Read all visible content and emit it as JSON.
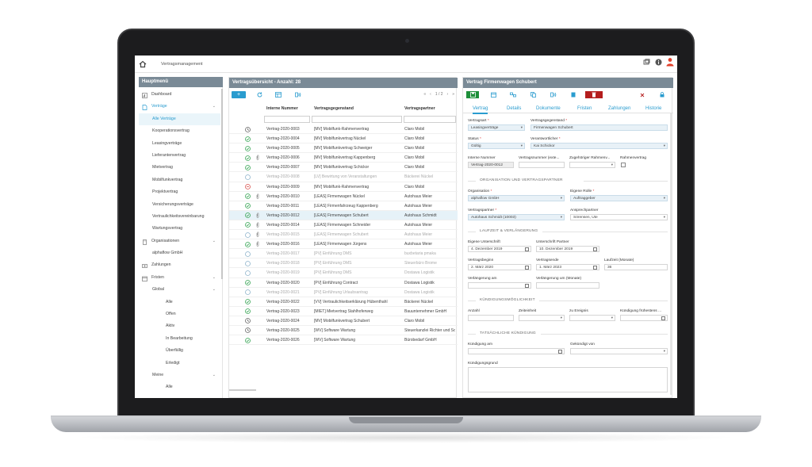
{
  "topbar": {
    "title": "Vertragsmanagement"
  },
  "sidebar": {
    "title": "Hauptmenü",
    "items": [
      {
        "label": "Dashboard",
        "icon": "dashboard-icon",
        "level": 0
      },
      {
        "label": "Verträge",
        "icon": "contract-icon",
        "level": 0,
        "open": true
      },
      {
        "label": "Alle Verträge",
        "level": 1,
        "active": true
      },
      {
        "label": "Kooperationsvertrag",
        "level": 1
      },
      {
        "label": "Leasingverträge",
        "level": 1
      },
      {
        "label": "Lieferantenvertrag",
        "level": 1
      },
      {
        "label": "Mietvertrag",
        "level": 1
      },
      {
        "label": "Mobilfunkvertrag",
        "level": 1
      },
      {
        "label": "Projektvertrag",
        "level": 1
      },
      {
        "label": "Versicherungsverträge",
        "level": 1
      },
      {
        "label": "Vertraulichkeitsvereinbarung",
        "level": 1
      },
      {
        "label": "Wartungsvertrag",
        "level": 1
      },
      {
        "label": "Organisationen",
        "icon": "organization-icon",
        "level": 0,
        "expandable": true
      },
      {
        "label": "alphaflow GmbH",
        "level": 1
      },
      {
        "label": "Zahlungen",
        "icon": "payment-icon",
        "level": 0
      },
      {
        "label": "Fristen",
        "icon": "deadline-icon",
        "level": 0,
        "expandable": true
      },
      {
        "label": "Global",
        "level": 1,
        "expandable": true
      },
      {
        "label": "Alle",
        "level": 2
      },
      {
        "label": "Offen",
        "level": 2
      },
      {
        "label": "Aktiv",
        "level": 2
      },
      {
        "label": "In Bearbeitung",
        "level": 2
      },
      {
        "label": "Überfällig",
        "level": 2
      },
      {
        "label": "Erledigt",
        "level": 2
      },
      {
        "label": "Meine",
        "level": 1,
        "expandable": true
      },
      {
        "label": "Alle",
        "level": 2
      }
    ]
  },
  "list": {
    "title": "Vertragsübersicht - Anzahl: 28",
    "add_label": "+",
    "pager": {
      "first": "«",
      "prev": "‹",
      "page": "1 / 2",
      "next": "›",
      "last": "»"
    },
    "columns": [
      "Interne Nummer",
      "Vertragsgegenstand",
      "Vertragspartner"
    ],
    "rows": [
      {
        "status": "clock",
        "clip": false,
        "num": "Vertrag-2020-0003",
        "subject": "[MV] Mobilfunk-Rahmenvertrag",
        "partner": "Claro Mobil",
        "dim": false
      },
      {
        "status": "ok",
        "clip": false,
        "num": "Vertrag-2020-0004",
        "subject": "[MV] Mobilfunkvertrag Nückel",
        "partner": "Claro Mobil",
        "dim": false
      },
      {
        "status": "ok",
        "clip": false,
        "num": "Vertrag-2020-0005",
        "subject": "[MV] Mobilfunkvertrag Schweiger",
        "partner": "Claro Mobil",
        "dim": false
      },
      {
        "status": "ok",
        "clip": true,
        "num": "Vertrag-2020-0006",
        "subject": "[MV] Mobilfunkvertrag Kappenberg",
        "partner": "Claro Mobil",
        "dim": false
      },
      {
        "status": "ok",
        "clip": false,
        "num": "Vertrag-2020-0007",
        "subject": "[MV] Mobilfunkvertrag Schickor",
        "partner": "Claro Mobil",
        "dim": false
      },
      {
        "status": "open",
        "clip": false,
        "num": "Vertrag-2020-0008",
        "subject": "[LV] Bewirtung von Veranstaltungen",
        "partner": "Bäckerei Nückel",
        "dim": true
      },
      {
        "status": "cancel",
        "clip": false,
        "num": "Vertrag-2020-0009",
        "subject": "[MV] Mobilfunk-Rahmenvertrag",
        "partner": "Claro Mobil",
        "dim": false
      },
      {
        "status": "ok",
        "clip": true,
        "num": "Vertrag-2020-0010",
        "subject": "[LEAS] Firmenwagen Nückel",
        "partner": "Autohaus Meier",
        "dim": false
      },
      {
        "status": "ok",
        "clip": false,
        "num": "Vertrag-2020-0011",
        "subject": "[LEAS] Firmenfahrzeug Kappenberg",
        "partner": "Autohaus Meier",
        "dim": false
      },
      {
        "status": "ok",
        "clip": true,
        "num": "Vertrag-2020-0012",
        "subject": "[LEAS] Firmenwagen Schubert",
        "partner": "Autohaus Schmidt",
        "dim": false,
        "selected": true
      },
      {
        "status": "ok",
        "clip": true,
        "num": "Vertrag-2020-0014",
        "subject": "[LEAS] Firmenwagen Schneider",
        "partner": "Autohaus Meier",
        "dim": false
      },
      {
        "status": "open",
        "clip": true,
        "num": "Vertrag-2020-0015",
        "subject": "[LEAS] Firmenwagen Schubert",
        "partner": "Autohaus Meier",
        "dim": true
      },
      {
        "status": "ok",
        "clip": true,
        "num": "Vertrag-2020-0016",
        "subject": "[LEAS] Firmenwagen Jürgens",
        "partner": "Autohaus Meier",
        "dim": false
      },
      {
        "status": "open",
        "clip": false,
        "num": "Vertrag-2020-0017",
        "subject": "[PV] Einführung DMS",
        "partner": "buxbetaria pmaka",
        "dim": true
      },
      {
        "status": "open",
        "clip": false,
        "num": "Vertrag-2020-0018",
        "subject": "[PV] Einführung DMS",
        "partner": "Steuerbüro Brome",
        "dim": true
      },
      {
        "status": "open",
        "clip": false,
        "num": "Vertrag-2020-0019",
        "subject": "[PV] Einführung DMS",
        "partner": "Dostawa Logistik",
        "dim": true
      },
      {
        "status": "ok",
        "clip": false,
        "num": "Vertrag-2020-0020",
        "subject": "[PV] Einführung Contract",
        "partner": "Dostawa Logistik",
        "dim": false
      },
      {
        "status": "open",
        "clip": false,
        "num": "Vertrag-2020-0021",
        "subject": "[PV] Einführung Urlaubsantrag",
        "partner": "Dostawa Logistik",
        "dim": true
      },
      {
        "status": "ok",
        "clip": false,
        "num": "Vertrag-2020-0022",
        "subject": "[VV] Vertraulichkeitserklärung Hübenthahl",
        "partner": "Bäckerei Nückel",
        "dim": false
      },
      {
        "status": "ok",
        "clip": false,
        "num": "Vertrag-2020-0023",
        "subject": "[MIET] Mietvertrag Stahlhoferweg",
        "partner": "Bauunternehmer GmbH",
        "dim": false
      },
      {
        "status": "clock",
        "clip": false,
        "num": "Vertrag-2020-0024",
        "subject": "[MV] Mobilfunkvertrag Schubert",
        "partner": "Claro Mobil",
        "dim": false
      },
      {
        "status": "clock",
        "clip": false,
        "num": "Vertrag-2020-0025",
        "subject": "[WV] Software Wartung",
        "partner": "Steuerkanzlei Richter und Sohn",
        "dim": false
      },
      {
        "status": "ok",
        "clip": false,
        "num": "Vertrag-2020-0026",
        "subject": "[WV] Software Wartung",
        "partner": "Bürobedarf GmbH",
        "dim": false
      }
    ]
  },
  "detail": {
    "title": "Vertrag Firmenwagen Schubert",
    "tabs": [
      "Vertrag",
      "Details",
      "Dokumente",
      "Fristen",
      "Zahlungen",
      "Historie"
    ],
    "fields": {
      "vertragsart_label": "Vertragsart",
      "vertragsart": "Leasingverträge",
      "gegenstand_label": "Vertragsgegenstand",
      "gegenstand": "Firmenwagen Schubert",
      "status_label": "Status",
      "status": "Gültig",
      "verantwortlicher_label": "Verantwortlicher",
      "verantwortlicher": "Kai Schickor",
      "interne_label": "Interne Nummer",
      "interne": "Vertrag-2020-0012",
      "vnummer_label": "Vertragsnummer (exte...",
      "rahmen_label": "Zugehöriger Rahmenv...",
      "rahmenvertrag_label": "Rahmenvertrag",
      "section_org": "ORGANISATION UND VERTRAGSPARTNER",
      "organisation_label": "Organisation",
      "organisation": "alphaflow GmbH",
      "rolle_label": "Eigene Rolle",
      "rolle": "Auftraggeber",
      "partner_label": "Vertragspartner",
      "partner": "Autohaus Schmidt (10003)",
      "ansprech_label": "Ansprechpartner",
      "ansprech": "Sörensen, Ute",
      "section_laufzeit": "LAUFZEIT & VERLÄNGERUNG",
      "eu_label": "Eigene Unterschrift",
      "eu": "4. Dezember 2019",
      "up_label": "Unterschrift Partner",
      "up": "10. Dezember 2019",
      "beginn_label": "Vertragsbeginn",
      "beginn": "2. März 2020",
      "ende_label": "Vertragsende",
      "ende": "1. März 2023",
      "laufzeit_label": "Laufzeit (Monate)",
      "laufzeit": "36",
      "verl_am_label": "Verlängerung am",
      "verl_um_label": "Verlängerung um (Monate)",
      "section_kuend": "KÜNDIGUNGSMÖGLICHKEIT",
      "anzahl_label": "Anzahl",
      "zeiteinheit_label": "Zeiteinheit",
      "ereignis_label": "zu Ereignis",
      "fruehestens_label": "Kündigung frühestens ...",
      "section_tats": "TATSÄCHLICHE KÜNDIGUNG",
      "kuend_am_label": "Kündigung am",
      "gekuend_label": "Gekündigt von",
      "grund_label": "Kündigungsgrund"
    }
  },
  "colors": {
    "accent": "#2a9ccf",
    "panel_header": "#7a8a96",
    "save_green": "#1e8f3a",
    "delete_red": "#b41d1d",
    "status_ok": "#3aa657",
    "status_cancel": "#d9534f"
  }
}
